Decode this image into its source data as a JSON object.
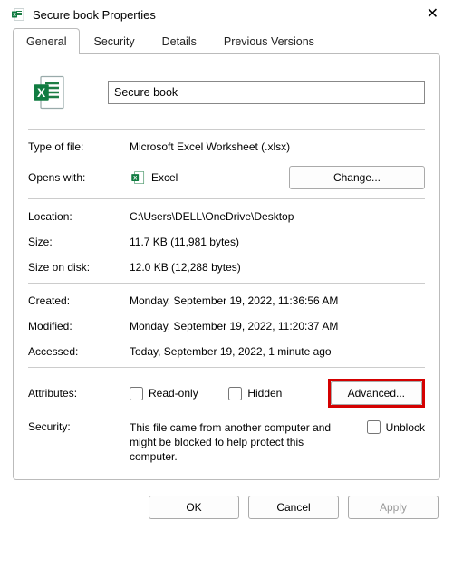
{
  "titlebar": {
    "title": "Secure book Properties",
    "close_glyph": "✕"
  },
  "tabs": {
    "general": "General",
    "security": "Security",
    "details": "Details",
    "previous": "Previous Versions"
  },
  "filename": "Secure book",
  "type_of_file": {
    "label": "Type of file:",
    "value": "Microsoft Excel Worksheet (.xlsx)"
  },
  "opens_with": {
    "label": "Opens with:",
    "app": "Excel",
    "change_btn": "Change..."
  },
  "location": {
    "label": "Location:",
    "value": "C:\\Users\\DELL\\OneDrive\\Desktop"
  },
  "size": {
    "label": "Size:",
    "value": "11.7 KB (11,981 bytes)"
  },
  "size_on_disk": {
    "label": "Size on disk:",
    "value": "12.0 KB (12,288 bytes)"
  },
  "created": {
    "label": "Created:",
    "value": "Monday, September 19, 2022, 11:36:56 AM"
  },
  "modified": {
    "label": "Modified:",
    "value": "Monday, September 19, 2022, 11:20:37 AM"
  },
  "accessed": {
    "label": "Accessed:",
    "value": "Today, September 19, 2022, 1 minute ago"
  },
  "attributes": {
    "label": "Attributes:",
    "readonly": "Read-only",
    "hidden": "Hidden",
    "advanced_btn": "Advanced..."
  },
  "security_row": {
    "label": "Security:",
    "text": "This file came from another computer and might be blocked to help protect this computer.",
    "unblock": "Unblock"
  },
  "footer": {
    "ok": "OK",
    "cancel": "Cancel",
    "apply": "Apply"
  },
  "icons": {
    "excel": "excel-icon",
    "close": "close-icon"
  }
}
